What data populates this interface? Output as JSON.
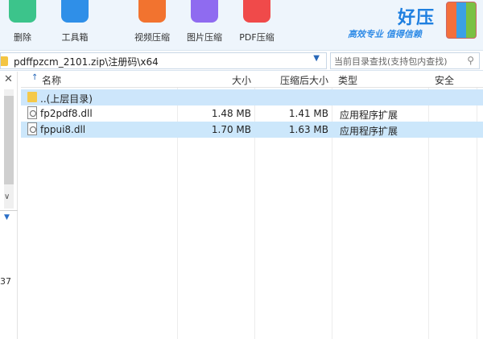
{
  "toolbar": {
    "items": [
      {
        "label": "删除",
        "icon": "recycle-icon",
        "color": "#3cc48b"
      },
      {
        "label": "工具箱",
        "icon": "toolbox-icon",
        "color": "#2f8fe8"
      },
      {
        "label": "视频压缩",
        "icon": "video-play-icon",
        "color": "#f2732f"
      },
      {
        "label": "图片压缩",
        "icon": "image-icon",
        "color": "#8f6bf0"
      },
      {
        "label": "PDF压缩",
        "icon": "pdf-icon",
        "color": "#f04a4a"
      }
    ]
  },
  "brand": {
    "title": "好压",
    "slogan": "高效专业 值得信赖"
  },
  "address": {
    "path": "pdffpzcm_2101.zip\\注册码\\x64",
    "search_placeholder": "当前目录查找(支持包内查找)"
  },
  "left_panel": {
    "number": "37"
  },
  "table": {
    "columns": {
      "name": "名称",
      "size": "大小",
      "packed": "压缩后大小",
      "type": "类型",
      "security": "安全"
    },
    "rows": [
      {
        "name": "..(上层目录)",
        "size": "",
        "packed": "",
        "type": "",
        "kind": "folder"
      },
      {
        "name": "fp2pdf8.dll",
        "size": "1.48 MB",
        "packed": "1.41 MB",
        "type": "应用程序扩展",
        "kind": "file"
      },
      {
        "name": "fppui8.dll",
        "size": "1.70 MB",
        "packed": "1.63 MB",
        "type": "应用程序扩展",
        "kind": "file"
      }
    ]
  },
  "colors": {
    "accent": "#1e7fe0",
    "selection": "#cde6fb"
  }
}
